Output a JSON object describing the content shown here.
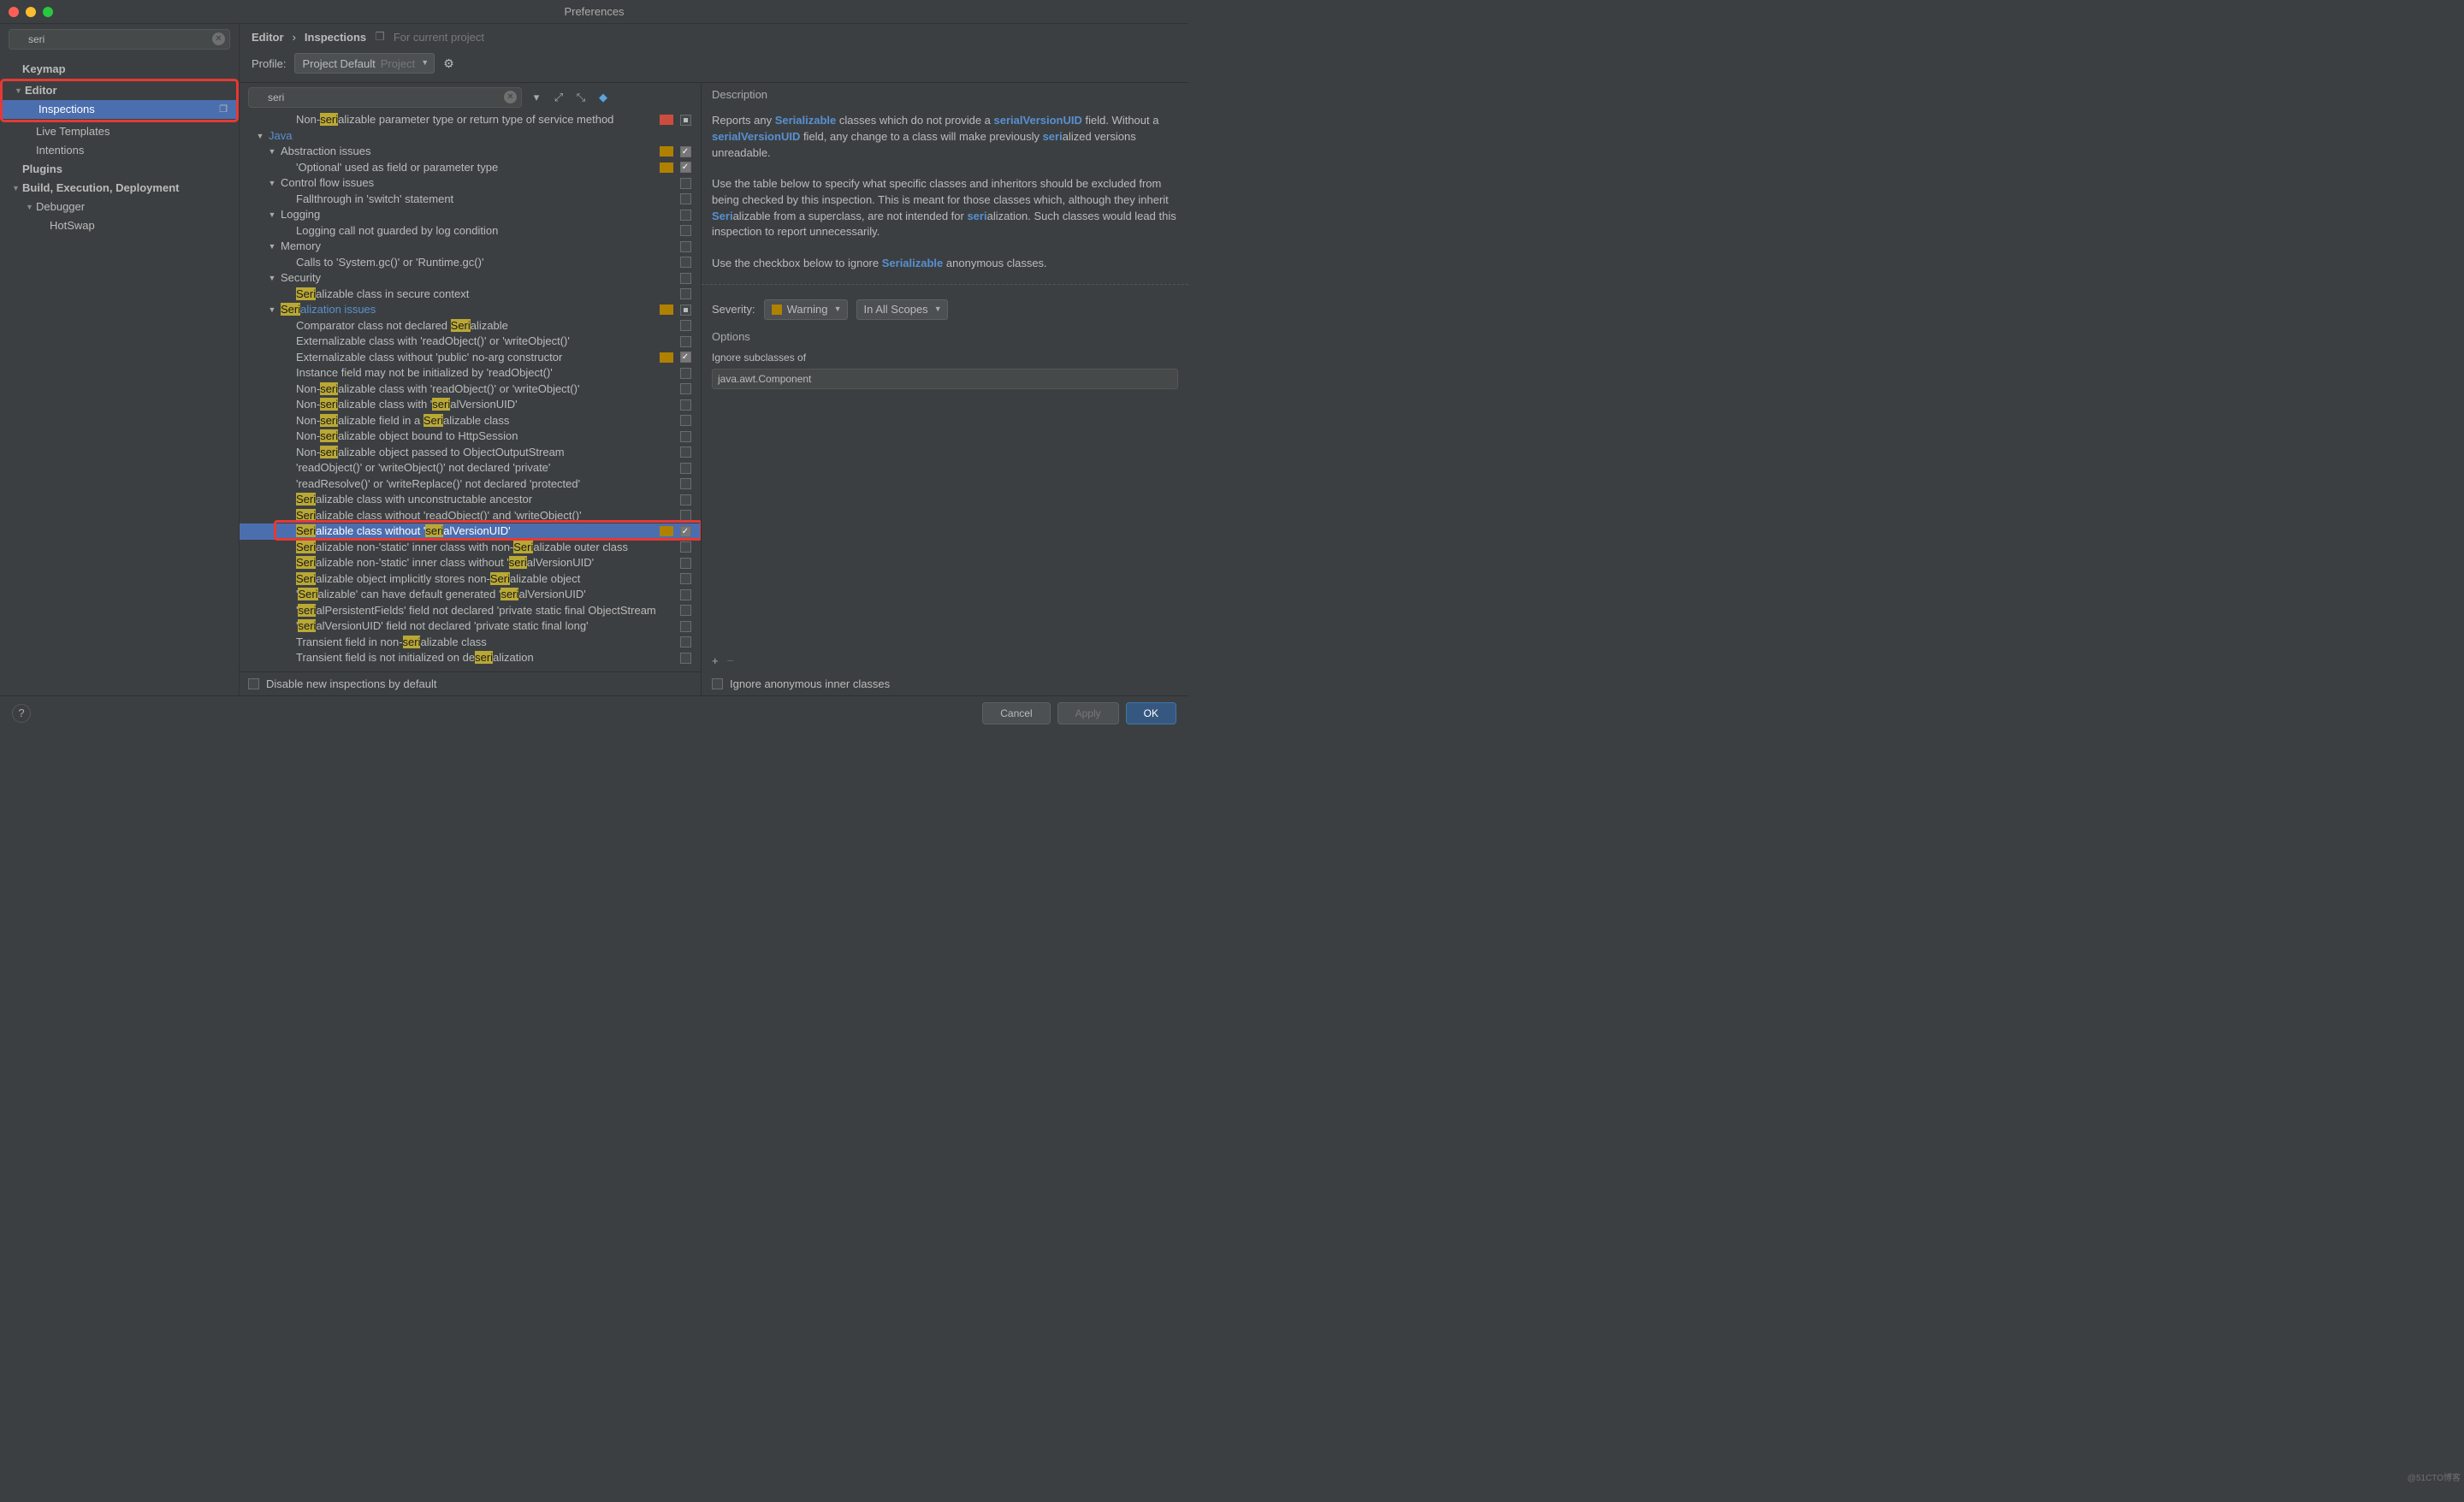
{
  "window": {
    "title": "Preferences"
  },
  "sidebar": {
    "search_value": "seri",
    "items": [
      {
        "label": "Keymap",
        "level": 0,
        "bold": true,
        "expander": ""
      },
      {
        "label": "Editor",
        "level": 0,
        "bold": true,
        "expander": "▼",
        "redboxStart": true
      },
      {
        "label": "Inspections",
        "level": 1,
        "bold": false,
        "expander": "",
        "selected": true,
        "badge": "❐",
        "redboxEnd": true
      },
      {
        "label": "Live Templates",
        "level": 1,
        "bold": false,
        "expander": ""
      },
      {
        "label": "Intentions",
        "level": 1,
        "bold": false,
        "expander": ""
      },
      {
        "label": "Plugins",
        "level": 0,
        "bold": true,
        "expander": ""
      },
      {
        "label": "Build, Execution, Deployment",
        "level": 0,
        "bold": true,
        "expander": "▼"
      },
      {
        "label": "Debugger",
        "level": 1,
        "bold": false,
        "expander": "▼"
      },
      {
        "label": "HotSwap",
        "level": 2,
        "bold": false,
        "expander": ""
      }
    ]
  },
  "breadcrumb": {
    "a": "Editor",
    "b": "Inspections",
    "hint": "For current project"
  },
  "profile": {
    "label": "Profile:",
    "combo_value": "Project Default",
    "combo_dim": "Project"
  },
  "inspect": {
    "search_value": "seri",
    "rows": [
      {
        "lvl": 2,
        "exp": "",
        "pre": "Non-",
        "hl": "seri",
        "post": "alizable parameter type or return type of service method",
        "sev": "err",
        "cb": "mix"
      },
      {
        "lvl": 0,
        "exp": "▼",
        "link": true,
        "pre": "",
        "hl": "",
        "post": "Java"
      },
      {
        "lvl": 1,
        "exp": "▼",
        "pre": "",
        "hl": "",
        "post": "Abstraction issues",
        "sev": "warn",
        "cb": "on"
      },
      {
        "lvl": 2,
        "exp": "",
        "pre": "'Optional' used as field or parameter type",
        "hl": "",
        "post": "",
        "sev": "warn",
        "cb": "on"
      },
      {
        "lvl": 1,
        "exp": "▼",
        "pre": "",
        "hl": "",
        "post": "Control flow issues",
        "cb": "off"
      },
      {
        "lvl": 2,
        "exp": "",
        "pre": "Fallthrough in 'switch' statement",
        "hl": "",
        "post": "",
        "cb": "off"
      },
      {
        "lvl": 1,
        "exp": "▼",
        "pre": "",
        "hl": "",
        "post": "Logging",
        "cb": "off"
      },
      {
        "lvl": 2,
        "exp": "",
        "pre": "Logging call not guarded by log condition",
        "hl": "",
        "post": "",
        "cb": "off"
      },
      {
        "lvl": 1,
        "exp": "▼",
        "pre": "",
        "hl": "",
        "post": "Memory",
        "cb": "off"
      },
      {
        "lvl": 2,
        "exp": "",
        "pre": "Calls to 'System.gc()' or 'Runtime.gc()'",
        "hl": "",
        "post": "",
        "cb": "off"
      },
      {
        "lvl": 1,
        "exp": "▼",
        "pre": "",
        "hl": "",
        "post": "Security",
        "cb": "off"
      },
      {
        "lvl": 2,
        "exp": "",
        "hlpre": "Seri",
        "post": "alizable class in secure context",
        "cb": "off"
      },
      {
        "lvl": 1,
        "exp": "▼",
        "link": true,
        "hlpre": "Seri",
        "post": "alization issues",
        "sev": "warn",
        "cb": "mix"
      },
      {
        "lvl": 2,
        "exp": "",
        "pre": "Comparator class not declared ",
        "hl": "Seri",
        "post": "alizable",
        "cb": "off"
      },
      {
        "lvl": 2,
        "exp": "",
        "pre": "Externalizable class with 'readObject()' or 'writeObject()'",
        "cb": "off"
      },
      {
        "lvl": 2,
        "exp": "",
        "pre": "Externalizable class without 'public' no-arg constructor",
        "sev": "warn",
        "cb": "on"
      },
      {
        "lvl": 2,
        "exp": "",
        "pre": "Instance field may not be initialized by 'readObject()'",
        "cb": "off"
      },
      {
        "lvl": 2,
        "exp": "",
        "pre": "Non-",
        "hl": "seri",
        "post": "alizable class with 'readObject()' or 'writeObject()'",
        "cb": "off"
      },
      {
        "lvl": 2,
        "exp": "",
        "pre": "Non-",
        "hl": "seri",
        "post": "alizable class with '",
        "hl2": "seri",
        "post2": "alVersionUID'",
        "cb": "off"
      },
      {
        "lvl": 2,
        "exp": "",
        "pre": "Non-",
        "hl": "seri",
        "post": "alizable field in a ",
        "hl2": "Seri",
        "post2": "alizable class",
        "cb": "off"
      },
      {
        "lvl": 2,
        "exp": "",
        "pre": "Non-",
        "hl": "seri",
        "post": "alizable object bound to HttpSession",
        "cb": "off"
      },
      {
        "lvl": 2,
        "exp": "",
        "pre": "Non-",
        "hl": "seri",
        "post": "alizable object passed to ObjectOutputStream",
        "cb": "off"
      },
      {
        "lvl": 2,
        "exp": "",
        "pre": "'readObject()' or 'writeObject()' not declared 'private'",
        "cb": "off"
      },
      {
        "lvl": 2,
        "exp": "",
        "pre": "'readResolve()' or 'writeReplace()' not declared 'protected'",
        "cb": "off"
      },
      {
        "lvl": 2,
        "exp": "",
        "hlpre": "Seri",
        "post": "alizable class with unconstructable ancestor",
        "cb": "off"
      },
      {
        "lvl": 2,
        "exp": "",
        "hlpre": "Seri",
        "post": "alizable class without 'readObject()' and 'writeObject()'",
        "cb": "off"
      },
      {
        "lvl": 2,
        "exp": "",
        "hlpre": "Seri",
        "post": "alizable class without '",
        "hl2": "seri",
        "post2": "alVersionUID'",
        "sev": "warn",
        "cb": "on",
        "selected": true,
        "redbox": true
      },
      {
        "lvl": 2,
        "exp": "",
        "hlpre": "Seri",
        "post": "alizable non-'static' inner class with non-",
        "hl2": "Seri",
        "post2": "alizable outer class",
        "cb": "off"
      },
      {
        "lvl": 2,
        "exp": "",
        "hlpre": "Seri",
        "post": "alizable non-'static' inner class without '",
        "hl2": "seri",
        "post2": "alVersionUID'",
        "cb": "off"
      },
      {
        "lvl": 2,
        "exp": "",
        "hlpre": "Seri",
        "post": "alizable object implicitly stores non-",
        "hl2": "Seri",
        "post2": "alizable object",
        "cb": "off"
      },
      {
        "lvl": 2,
        "exp": "",
        "pre": "'",
        "hl": "Seri",
        "post": "alizable' can have default generated '",
        "hl2": "seri",
        "post2": "alVersionUID'",
        "cb": "off"
      },
      {
        "lvl": 2,
        "exp": "",
        "pre": "'",
        "hl": "seri",
        "post": "alPersistentFields' field not declared 'private static final ObjectStream",
        "cb": "off"
      },
      {
        "lvl": 2,
        "exp": "",
        "pre": "'",
        "hl": "seri",
        "post": "alVersionUID' field not declared 'private static final long'",
        "cb": "off"
      },
      {
        "lvl": 2,
        "exp": "",
        "pre": "Transient field in non-",
        "hl": "seri",
        "post": "alizable class",
        "cb": "off"
      },
      {
        "lvl": 2,
        "exp": "",
        "pre": "Transient field is not initialized on de",
        "hl": "seri",
        "post": "alization",
        "cb": "off"
      }
    ],
    "footer_label": "Disable new inspections by default"
  },
  "detail": {
    "header": "Description",
    "para1_a": "Reports any ",
    "para1_b": "Serializable",
    "para1_c": " classes which do not provide a ",
    "para1_d": "serialVersionUID",
    "para1_e": " field. Without a ",
    "para1_f": "serialVersionUID",
    "para1_g": " field, any change to a class will make previously ",
    "para1_h": "seri",
    "para1_i": "alized versions unreadable.",
    "para2_a": "Use the table below to specify what specific classes and inheritors should be excluded from being checked by this inspection. This is meant for those classes which, although they inherit ",
    "para2_b": "Seri",
    "para2_c": "alizable from a superclass, are not intended for ",
    "para2_d": "seri",
    "para2_e": "alization. Such classes would lead this inspection to report unnecessarily.",
    "para3_a": "Use the checkbox below to ignore ",
    "para3_b": "Serializable",
    "para3_c": " anonymous classes.",
    "severity_label": "Severity:",
    "severity_value": "Warning",
    "scope_value": "In All Scopes",
    "options_label": "Options",
    "ignore_label": "Ignore subclasses of",
    "ignore_value": "java.awt.Component",
    "anon_label": "Ignore anonymous inner classes"
  },
  "footer": {
    "cancel": "Cancel",
    "apply": "Apply",
    "ok": "OK"
  },
  "watermark": "@51CTO博客"
}
